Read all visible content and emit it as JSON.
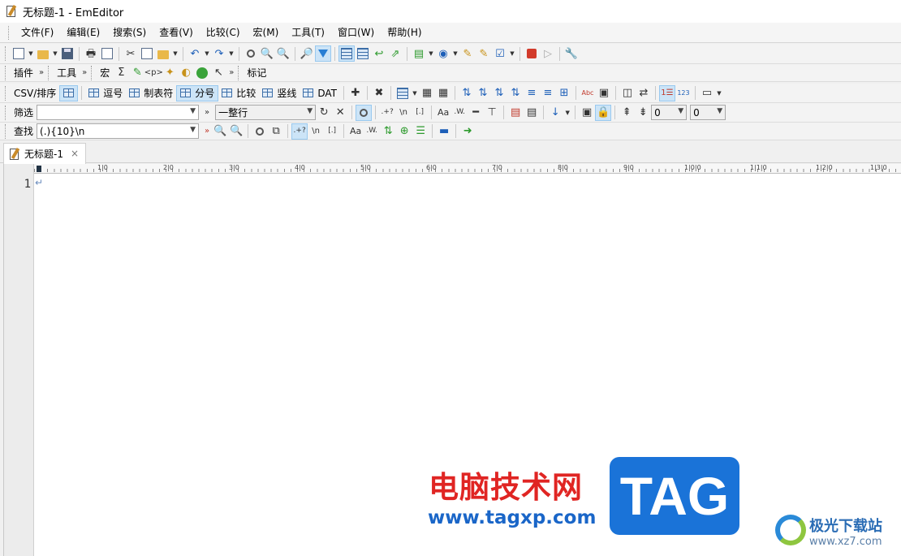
{
  "window": {
    "title": "无标题-1 - EmEditor"
  },
  "menu": [
    "文件(F)",
    "编辑(E)",
    "搜索(S)",
    "查看(V)",
    "比较(C)",
    "宏(M)",
    "工具(T)",
    "窗口(W)",
    "帮助(H)"
  ],
  "toolbar2": {
    "plugins_label": "插件",
    "tools_label": "工具",
    "macro_label": "宏",
    "sigma_glyph": "Σ",
    "tag_glyph": "<p>",
    "marks_label": "标记"
  },
  "csvbar": {
    "label": "CSV/排序",
    "buttons": [
      "逗号",
      "制表符",
      "分号",
      "比较",
      "竖线",
      "DAT"
    ],
    "line_numbers_glyph": "123",
    "abc_glyph": "Abc"
  },
  "filterbar": {
    "label": "筛选",
    "filter_value": "",
    "mode_value": "一整行",
    "regex_glyph": ".+?",
    "newline_glyph": "\\n",
    "bracket_glyph": "[.]",
    "case_glyph": "Aa",
    "word_glyph": ".W.",
    "num1_value": "0",
    "num2_value": "0"
  },
  "findbar": {
    "label": "查找",
    "find_value": "(.){10}\\n",
    "regex_glyph": ".+?",
    "newline_glyph": "\\n",
    "bracket_glyph": "[.]",
    "case_glyph": "Aa",
    "word_glyph": ".W."
  },
  "tabs": [
    {
      "label": "无标题-1",
      "close": "×"
    }
  ],
  "ruler": {
    "marks": [
      "1|0",
      "2|0",
      "3|0",
      "4|0",
      "5|0",
      "6|0",
      "7|0",
      "8|0",
      "9|0",
      "1|0|0",
      "1|1|0",
      "1|2|0",
      "1|3|0"
    ]
  },
  "editor": {
    "line_number": "1",
    "eol_mark": "↵"
  },
  "watermark": {
    "cn_text": "电脑技术网",
    "url": "www.tagxp.com",
    "tag": "TAG",
    "logo_cn": "极光下载站",
    "logo_en": "www.xz7.com"
  },
  "colors": {
    "accent": "#1a73d8",
    "pressed_bg": "#cce4f7",
    "watermark_red": "#e02523"
  }
}
